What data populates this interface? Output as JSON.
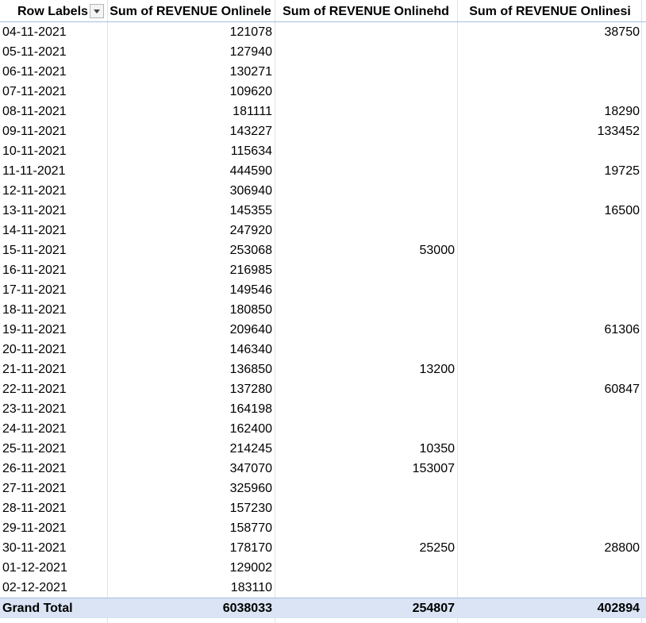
{
  "pivot": {
    "headers": {
      "row_labels": "Row Labels",
      "col1": "Sum of REVENUE Onlinele",
      "col2": "Sum of REVENUE Onlinehd",
      "col3": "Sum of REVENUE Onlinesi"
    },
    "filter_icon": "dropdown-arrow-icon",
    "rows": [
      {
        "date": "04-11-2021",
        "le": "121078",
        "hd": "",
        "si": "38750"
      },
      {
        "date": "05-11-2021",
        "le": "127940",
        "hd": "",
        "si": ""
      },
      {
        "date": "06-11-2021",
        "le": "130271",
        "hd": "",
        "si": ""
      },
      {
        "date": "07-11-2021",
        "le": "109620",
        "hd": "",
        "si": ""
      },
      {
        "date": "08-11-2021",
        "le": "181111",
        "hd": "",
        "si": "18290"
      },
      {
        "date": "09-11-2021",
        "le": "143227",
        "hd": "",
        "si": "133452"
      },
      {
        "date": "10-11-2021",
        "le": "115634",
        "hd": "",
        "si": ""
      },
      {
        "date": "11-11-2021",
        "le": "444590",
        "hd": "",
        "si": "19725"
      },
      {
        "date": "12-11-2021",
        "le": "306940",
        "hd": "",
        "si": ""
      },
      {
        "date": "13-11-2021",
        "le": "145355",
        "hd": "",
        "si": "16500"
      },
      {
        "date": "14-11-2021",
        "le": "247920",
        "hd": "",
        "si": ""
      },
      {
        "date": "15-11-2021",
        "le": "253068",
        "hd": "53000",
        "si": ""
      },
      {
        "date": "16-11-2021",
        "le": "216985",
        "hd": "",
        "si": ""
      },
      {
        "date": "17-11-2021",
        "le": "149546",
        "hd": "",
        "si": ""
      },
      {
        "date": "18-11-2021",
        "le": "180850",
        "hd": "",
        "si": ""
      },
      {
        "date": "19-11-2021",
        "le": "209640",
        "hd": "",
        "si": "61306"
      },
      {
        "date": "20-11-2021",
        "le": "146340",
        "hd": "",
        "si": ""
      },
      {
        "date": "21-11-2021",
        "le": "136850",
        "hd": "13200",
        "si": ""
      },
      {
        "date": "22-11-2021",
        "le": "137280",
        "hd": "",
        "si": "60847"
      },
      {
        "date": "23-11-2021",
        "le": "164198",
        "hd": "",
        "si": ""
      },
      {
        "date": "24-11-2021",
        "le": "162400",
        "hd": "",
        "si": ""
      },
      {
        "date": "25-11-2021",
        "le": "214245",
        "hd": "10350",
        "si": ""
      },
      {
        "date": "26-11-2021",
        "le": "347070",
        "hd": "153007",
        "si": ""
      },
      {
        "date": "27-11-2021",
        "le": "325960",
        "hd": "",
        "si": ""
      },
      {
        "date": "28-11-2021",
        "le": "157230",
        "hd": "",
        "si": ""
      },
      {
        "date": "29-11-2021",
        "le": "158770",
        "hd": "",
        "si": ""
      },
      {
        "date": "30-11-2021",
        "le": "178170",
        "hd": "25250",
        "si": "28800"
      },
      {
        "date": "01-12-2021",
        "le": "129002",
        "hd": "",
        "si": ""
      },
      {
        "date": "02-12-2021",
        "le": "183110",
        "hd": "",
        "si": ""
      }
    ],
    "grand_total": {
      "label": "Grand Total",
      "le": "6038033",
      "hd": "254807",
      "si": "402894"
    },
    "colors": {
      "total_row_bg": "#dae4f4",
      "border_accent": "#a6bce4",
      "gridline": "#e2e2e2"
    }
  }
}
